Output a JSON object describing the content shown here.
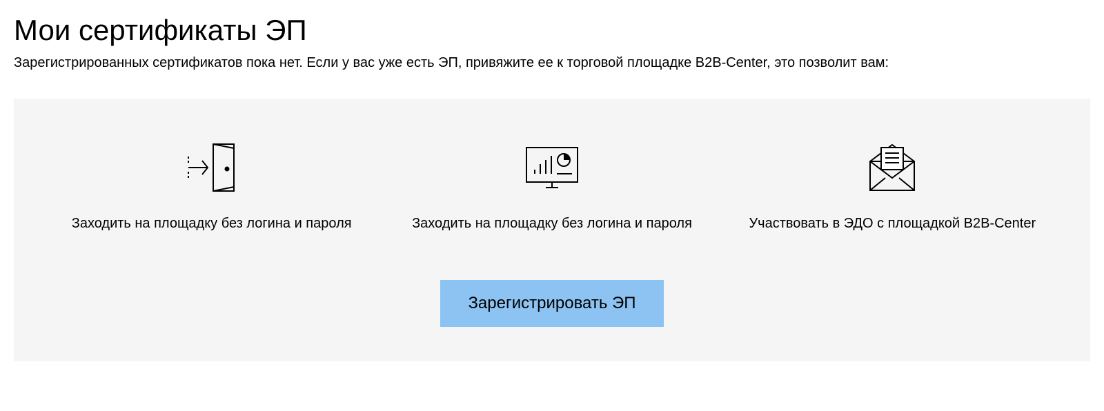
{
  "header": {
    "title": "Мои сертификаты ЭП",
    "subtitle": "Зарегистрированных сертификатов пока нет. Если у вас уже есть ЭП, привяжите ее к торговой площадке B2B-Center, это позволит вам:"
  },
  "benefits": [
    {
      "icon": "login-door-icon",
      "text": "Заходить на площадку без логина и пароля"
    },
    {
      "icon": "analytics-monitor-icon",
      "text": "Заходить на площадку без логина и пароля"
    },
    {
      "icon": "envelope-document-icon",
      "text": "Участвовать в ЭДО с площадкой B2B-Center"
    }
  ],
  "cta": {
    "register_label": "Зарегистрировать ЭП"
  }
}
